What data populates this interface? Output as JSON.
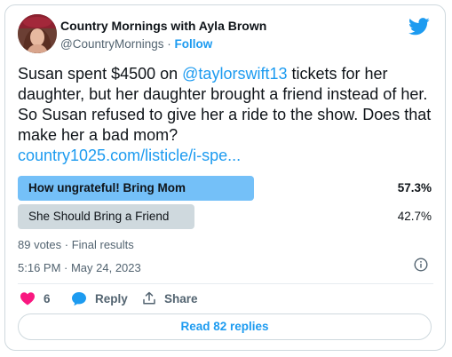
{
  "author": {
    "name": "Country Mornings with Ayla Brown",
    "handle": "@CountryMornings",
    "separator": " · ",
    "follow_label": "Follow"
  },
  "tweet": {
    "text_part1": "Susan spent $4500 on ",
    "mention": "@taylorswift13",
    "text_part2": "  tickets for her daughter, but her daughter brought a friend instead of her. So Susan refused to give her a ride to the show. Does that make her a bad mom?",
    "link": "country1025.com/listicle/i-spe..."
  },
  "poll": {
    "options": [
      {
        "label": "How ungrateful! Bring Mom",
        "percent": "57.3%",
        "share": 0.573
      },
      {
        "label": "She Should Bring a Friend",
        "percent": "42.7%",
        "share": 0.427
      }
    ],
    "summary": "89 votes · Final results"
  },
  "timestamp": "5:16 PM · May 24, 2023",
  "actions": {
    "like_count": "6",
    "reply_label": "Reply",
    "share_label": "Share"
  },
  "read_replies_label": "Read 82 replies",
  "colors": {
    "accent": "#1d9bf0",
    "winning_bar": "#74c0f8",
    "losing_bar": "#cfd9de",
    "like": "#f91880"
  },
  "icons": [
    "twitter-bird-icon",
    "info-icon",
    "heart-icon",
    "reply-bubble-icon",
    "share-icon"
  ]
}
